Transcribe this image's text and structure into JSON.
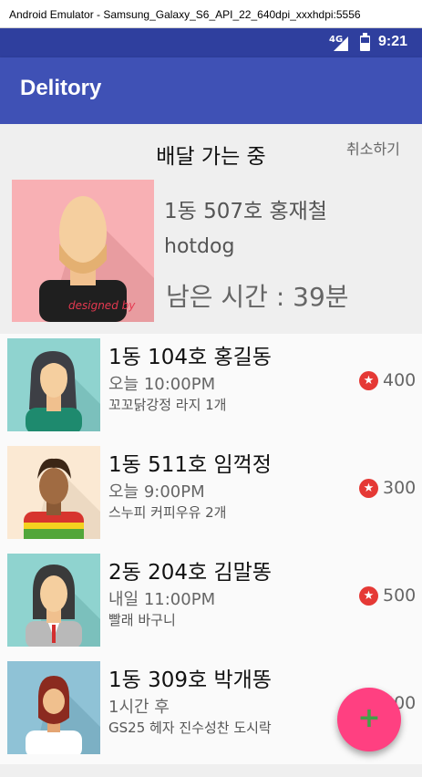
{
  "window": {
    "title": "Android Emulator - Samsung_Galaxy_S6_API_22_640dpi_xxxhdpi:5556"
  },
  "status_bar": {
    "network": "4G",
    "time": "9:21"
  },
  "app_bar": {
    "title": "Delitory"
  },
  "current_delivery": {
    "heading": "배달 가는 중",
    "cancel_label": "취소하기",
    "address": "1동 507호 홍재철",
    "item": "hotdog",
    "remaining": "남은 시간 : 39분",
    "photo_caption": "designed by"
  },
  "orders": [
    {
      "address": "1동 104호 홍길동",
      "time": "오늘 10:00PM",
      "description": "꼬꼬닭강정 라지 1개",
      "points": "400"
    },
    {
      "address": "1동 511호 임꺽정",
      "time": "오늘 9:00PM",
      "description": "스누피 커피우유 2개",
      "points": "300"
    },
    {
      "address": "2동 204호 김말똥",
      "time": "내일 11:00PM",
      "description": "빨래 바구니",
      "points": "500"
    },
    {
      "address": "1동 309호 박개똥",
      "time": "1시간 후",
      "description": "GS25 헤자 진수성찬 도시락",
      "points": "500"
    }
  ],
  "fab": {
    "label": "+"
  },
  "colors": {
    "primary": "#3f51b5",
    "primary_dark": "#2f3f9e",
    "accent": "#ff4081",
    "star": "#e53935"
  },
  "icons": {
    "points": "star-icon",
    "add": "plus-icon"
  }
}
